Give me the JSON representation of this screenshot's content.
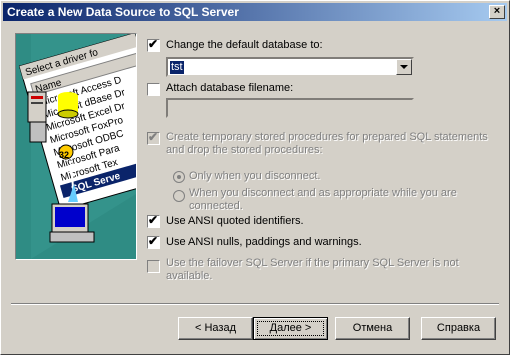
{
  "window": {
    "title": "Create a New Data Source to SQL Server",
    "close_glyph": "×"
  },
  "illustration": {
    "driver_list_header": "Select a driver fo",
    "column_header": "Name",
    "drivers": [
      "Microsoft Access D",
      "Microsoft dBase Dr",
      "Microsoft Excel Dr",
      "Microsoft FoxPro",
      "Microsoft ODBC",
      "Microsoft Para",
      "Microsoft Tex"
    ],
    "highlighted_driver": "SQL Serve",
    "badge": "32"
  },
  "options": {
    "change_default_db": {
      "label": "Change the default database to:",
      "checked": true
    },
    "database_value": "tst",
    "attach_db": {
      "label": "Attach database filename:",
      "checked": false
    },
    "attach_value": "",
    "temp_procs": {
      "label_line1": "Create temporary stored procedures for prepared SQL statements",
      "label_line2": "and drop the stored procedures:",
      "checked": true,
      "disabled": true
    },
    "radio_only_disconnect": {
      "label": "Only when you disconnect.",
      "selected": true
    },
    "radio_disconnect_and": {
      "label_line1": "When you disconnect and as appropriate while you are",
      "label_line2": "connected.",
      "selected": false
    },
    "ansi_quoted": {
      "label": "Use ANSI quoted identifiers.",
      "checked": true
    },
    "ansi_nulls": {
      "label": "Use ANSI nulls, paddings and warnings.",
      "checked": true
    },
    "failover": {
      "label_line1": "Use the failover SQL Server if the primary SQL Server is not",
      "label_line2": "available.",
      "checked": false,
      "disabled": true
    }
  },
  "buttons": {
    "back": "< Назад",
    "next": "Далее >",
    "cancel": "Отмена",
    "help": "Справка"
  }
}
